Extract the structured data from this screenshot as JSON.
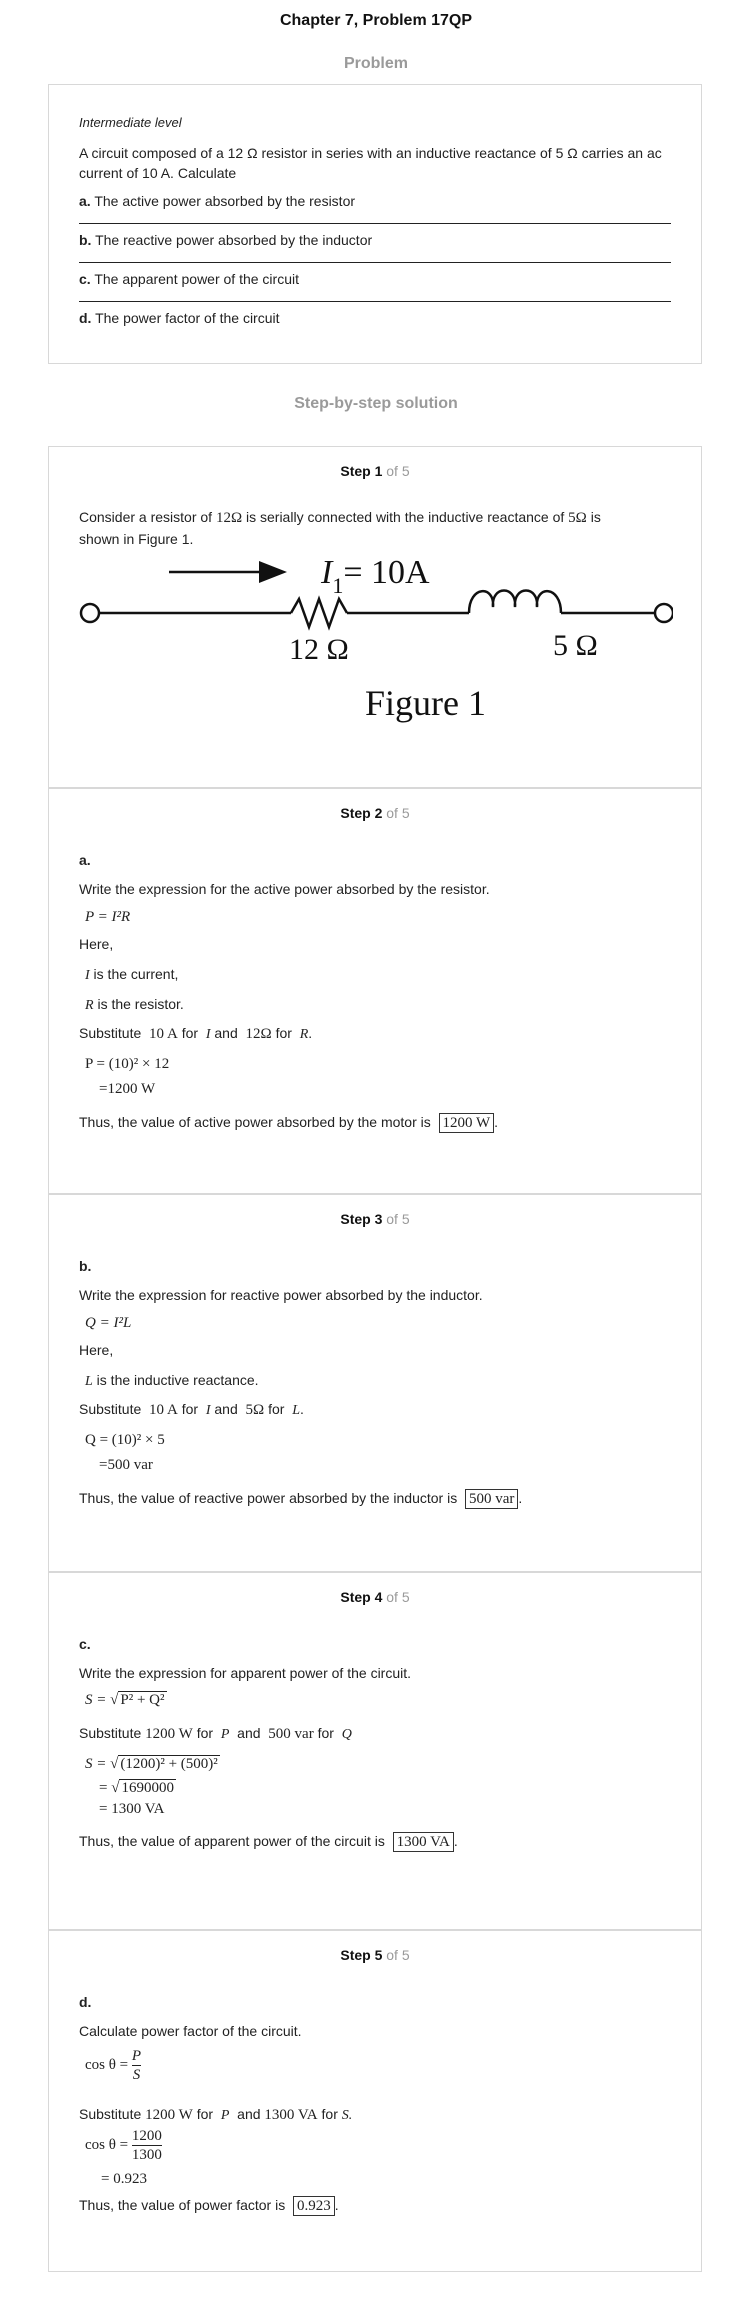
{
  "header": {
    "title": "Chapter 7, Problem 17QP",
    "problem_label": "Problem",
    "solution_label": "Step-by-step solution"
  },
  "problem": {
    "level": "Intermediate level",
    "statement": "A circuit composed of a 12 Ω resistor in series with an inductive reactance of 5 Ω carries an ac current of 10 A. Calculate",
    "parts": [
      {
        "letter": "a.",
        "text": " The active power absorbed by the resistor"
      },
      {
        "letter": "b.",
        "text": " The reactive power absorbed by the inductor"
      },
      {
        "letter": "c.",
        "text": " The apparent power of the circuit"
      },
      {
        "letter": "d.",
        "text": " The power factor of the circuit"
      }
    ]
  },
  "steps": [
    {
      "label": "Step 1",
      "of": "of 5",
      "text1": "Consider a resistor of",
      "r": "12Ω",
      "text2": "is serially connected with the inductive reactance of",
      "x": "5Ω",
      "text3": "is",
      "text4": "shown in Figure 1.",
      "figure": {
        "current": "I",
        "current_sub": "1",
        "current_val": "= 10A",
        "r_label": "12 Ω",
        "l_label": "5 Ω",
        "caption": "Figure 1"
      }
    },
    {
      "label": "Step 2",
      "of": "of 5",
      "part": "a.",
      "intro": "Write the expression for the active power absorbed by the resistor.",
      "formula": "P = I²R",
      "here": "Here,",
      "def1_var": "I",
      "def1": " is the current,",
      "def2_var": "R",
      "def2": " is the resistor.",
      "subst": "Substitute",
      "v1": "10 A",
      "for": "for",
      "var1": "I",
      "and": "and",
      "v2": "12Ω",
      "var2": "R",
      "calc1": "P = (10)² × 12",
      "calc2": "=1200 W",
      "result_text": "Thus, the value of active power absorbed by the motor is",
      "result": "1200 W"
    },
    {
      "label": "Step 3",
      "of": "of 5",
      "part": "b.",
      "intro": "Write the expression for reactive power absorbed by the inductor.",
      "formula": "Q = I²L",
      "here": "Here,",
      "def1_var": "L",
      "def1": " is the inductive reactance.",
      "subst": "Substitute",
      "v1": "10 A",
      "for": "for",
      "var1": "I",
      "and": "and",
      "v2": "5Ω",
      "var2": "L",
      "calc1": "Q = (10)² × 5",
      "calc2": "=500 var",
      "result_text": "Thus, the value of reactive power absorbed by the inductor is",
      "result": "500 var"
    },
    {
      "label": "Step 4",
      "of": "of 5",
      "part": "c.",
      "intro": "Write the expression for apparent power of the circuit.",
      "formula_lhs": "S = ",
      "formula_rad": "P² + Q²",
      "subst": "Substitute",
      "v1": "1200 W",
      "for": "for",
      "var1": "P",
      "and": "and",
      "v2": "500 var",
      "var2": "Q",
      "calc1_lhs": "S = ",
      "calc1_rad": "(1200)² + (500)²",
      "calc2_lhs": "= ",
      "calc2_rad": "1690000",
      "calc3": "= 1300 VA",
      "result_text": "Thus, the value of apparent power of the circuit is",
      "result": "1300 VA"
    },
    {
      "label": "Step 5",
      "of": "of 5",
      "part": "d.",
      "intro": "Calculate power factor of the circuit.",
      "formula_lhs": "cos θ = ",
      "formula_num": "P",
      "formula_den": "S",
      "subst": "Substitute",
      "v1": "1200 W",
      "for": "for",
      "var1": "P",
      "and": "and",
      "v2": "1300 VA",
      "var2": "S.",
      "calc_lhs": "cos θ = ",
      "calc_num": "1200",
      "calc_den": "1300",
      "calc2": "= 0.923",
      "result_text": "Thus, the value of power factor is",
      "result": "0.923"
    }
  ]
}
